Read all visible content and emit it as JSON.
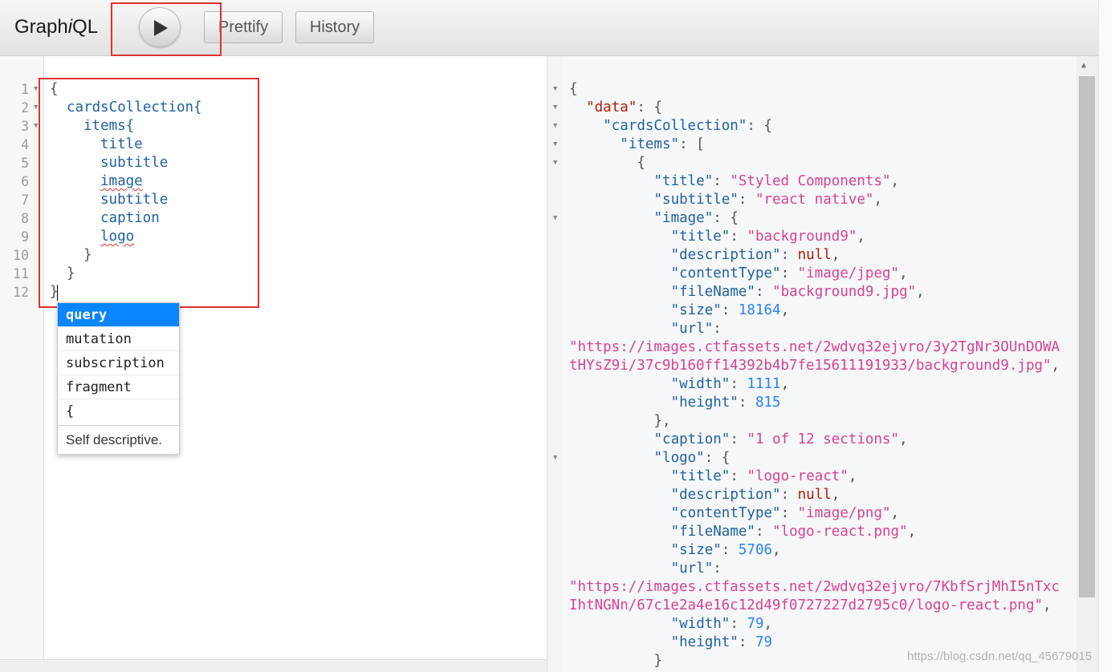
{
  "app": {
    "logo_prefix": "Graph",
    "logo_italic": "i",
    "logo_suffix": "QL"
  },
  "toolbar": {
    "run_icon": "play-icon",
    "prettify_label": "Prettify",
    "history_label": "History"
  },
  "query": {
    "line_numbers": [
      "1",
      "2",
      "3",
      "4",
      "5",
      "6",
      "7",
      "8",
      "9",
      "10",
      "11",
      "12"
    ],
    "lines": [
      "{",
      "cardsCollection{",
      "items{",
      "title",
      "subtitle",
      "image",
      "subtitle",
      "caption",
      "logo",
      "}",
      "}",
      "}"
    ]
  },
  "autocomplete": {
    "items": [
      "query",
      "mutation",
      "subscription",
      "fragment",
      "{"
    ],
    "selected": "query",
    "description": "Self descriptive."
  },
  "result": {
    "open_brace": "{",
    "data_key": "\"data\"",
    "cards_key": "\"cardsCollection\"",
    "items_key": "\"items\"",
    "items": [
      {
        "title": "\"Styled Components\"",
        "subtitle": "\"react native\"",
        "image": {
          "title": "\"background9\"",
          "description": "null",
          "contentType": "\"image/jpeg\"",
          "fileName": "\"background9.jpg\"",
          "size": "18164",
          "url_line1": "\"https://images.ctfassets.net/2wdvq32ejvro/3y2TgNr3OUnDOWA",
          "url_line2": "tHYsZ9i/37c9b160ff14392b4b7fe15611191933/background9.jpg\"",
          "width": "1111",
          "height": "815"
        },
        "caption": "\"1 of 12 sections\"",
        "logo": {
          "title": "\"logo-react\"",
          "description": "null",
          "contentType": "\"image/png\"",
          "fileName": "\"logo-react.png\"",
          "size": "5706",
          "url_line1": "\"https://images.ctfassets.net/2wdvq32ejvro/7KbfSrjMhI5nTxc",
          "url_line2": "IhtNGNn/67c1e2a4e16c12d49f0727227d2795c0/logo-react.png\"",
          "width": "79",
          "height": "79"
        }
      }
    ]
  },
  "watermark": "https://blog.csdn.net/qq_45679015",
  "colors": {
    "highlight": "#e03131",
    "selection": "#0a84ff",
    "string": "#d64292",
    "number": "#2882f9",
    "key": "#1f61a0"
  }
}
